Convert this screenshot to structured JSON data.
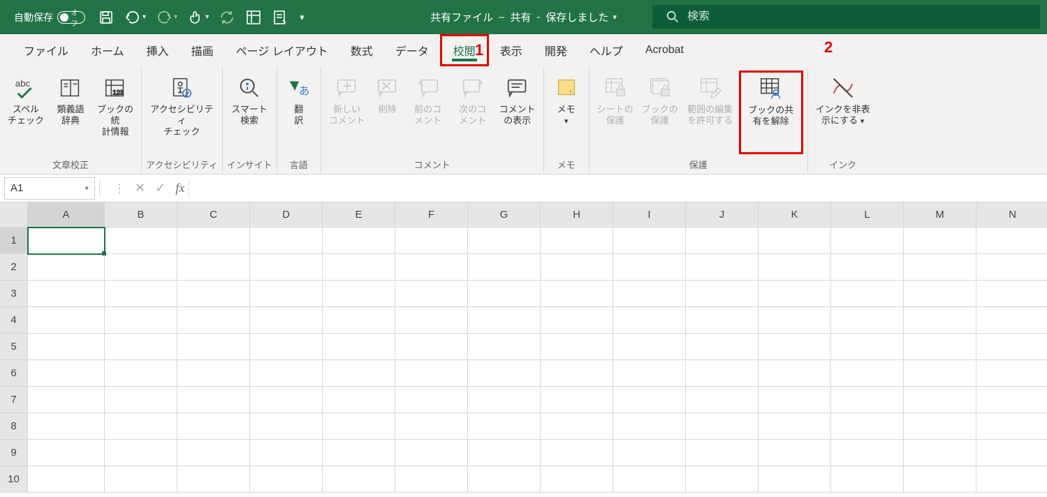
{
  "titlebar": {
    "autosave_label": "自動保存",
    "autosave_off": "オフ",
    "doc_title": "共有ファイル",
    "share_status": "共有",
    "save_status": "保存しました",
    "search_placeholder": "検索"
  },
  "tabs": [
    {
      "label": "ファイル"
    },
    {
      "label": "ホーム"
    },
    {
      "label": "挿入"
    },
    {
      "label": "描画"
    },
    {
      "label": "ページ レイアウト"
    },
    {
      "label": "数式"
    },
    {
      "label": "データ"
    },
    {
      "label": "校閲",
      "active": true,
      "highlight": true
    },
    {
      "label": "表示"
    },
    {
      "label": "開発"
    },
    {
      "label": "ヘルプ"
    },
    {
      "label": "Acrobat"
    }
  ],
  "annotations": {
    "a1": "1",
    "a2": "2"
  },
  "ribbon": {
    "groups": [
      {
        "label": "文章校正",
        "buttons": [
          {
            "name": "spellcheck",
            "label": "スペル\nチェック"
          },
          {
            "name": "thesaurus",
            "label": "類義語\n辞典"
          },
          {
            "name": "workbook-stats",
            "label": "ブックの統\n計情報"
          }
        ]
      },
      {
        "label": "アクセシビリティ",
        "buttons": [
          {
            "name": "accessibility-check",
            "label": "アクセシビリティ\nチェック"
          }
        ]
      },
      {
        "label": "インサイト",
        "buttons": [
          {
            "name": "smart-lookup",
            "label": "スマート\n検索"
          }
        ]
      },
      {
        "label": "言語",
        "buttons": [
          {
            "name": "translate",
            "label": "翻\n訳"
          }
        ]
      },
      {
        "label": "コメント",
        "buttons": [
          {
            "name": "new-comment",
            "label": "新しい\nコメント",
            "disabled": true
          },
          {
            "name": "delete-comment",
            "label": "削除",
            "disabled": true
          },
          {
            "name": "prev-comment",
            "label": "前のコ\nメント",
            "disabled": true
          },
          {
            "name": "next-comment",
            "label": "次のコ\nメント",
            "disabled": true
          },
          {
            "name": "show-comments",
            "label": "コメント\nの表示"
          }
        ]
      },
      {
        "label": "メモ",
        "buttons": [
          {
            "name": "notes",
            "label": "メモ",
            "dropdown": true
          }
        ]
      },
      {
        "label": "保護",
        "buttons": [
          {
            "name": "protect-sheet",
            "label": "シートの\n保護",
            "disabled": true
          },
          {
            "name": "protect-workbook",
            "label": "ブックの\n保護",
            "disabled": true
          },
          {
            "name": "allow-edit-ranges",
            "label": "範囲の編集\nを許可する",
            "disabled": true
          },
          {
            "name": "unshare-workbook",
            "label": "ブックの共\n有を解除",
            "highlight": true
          }
        ]
      },
      {
        "label": "インク",
        "buttons": [
          {
            "name": "hide-ink",
            "label": "インクを非表\n示にする",
            "dropdown": true
          }
        ]
      }
    ]
  },
  "formula_bar": {
    "cell_ref": "A1",
    "formula": ""
  },
  "sheet": {
    "columns": [
      "A",
      "B",
      "C",
      "D",
      "E",
      "F",
      "G",
      "H",
      "I",
      "J",
      "K",
      "L",
      "M",
      "N"
    ],
    "rows": [
      "1",
      "2",
      "3",
      "4",
      "5",
      "6",
      "7",
      "8",
      "9",
      "10"
    ],
    "selected": "A1"
  }
}
